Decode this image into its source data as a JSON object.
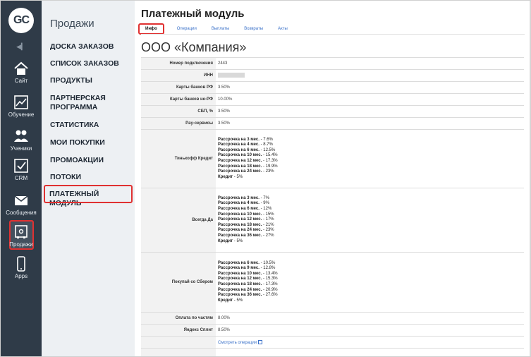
{
  "app": {
    "logo_text": "GC"
  },
  "rail": {
    "items": [
      {
        "label": "Сайт",
        "icon": "home-icon"
      },
      {
        "label": "Обучение",
        "icon": "chart-icon"
      },
      {
        "label": "Ученики",
        "icon": "users-icon"
      },
      {
        "label": "CRM",
        "icon": "checkbox-icon"
      },
      {
        "label": "Сообщения",
        "icon": "mail-icon"
      },
      {
        "label": "Продажи",
        "icon": "safe-icon",
        "active": true
      },
      {
        "label": "Apps",
        "icon": "phone-icon"
      }
    ]
  },
  "section_nav": {
    "title": "Продажи",
    "items": [
      {
        "label": "ДОСКА ЗАКАЗОВ"
      },
      {
        "label": "СПИСОК ЗАКАЗОВ"
      },
      {
        "label": "ПРОДУКТЫ"
      },
      {
        "label": "ПАРТНЕРСКАЯ ПРОГРАММА"
      },
      {
        "label": "СТАТИСТИКА"
      },
      {
        "label": "МОИ ПОКУПКИ"
      },
      {
        "label": "ПРОМОАКЦИИ"
      },
      {
        "label": "ПОТОКИ"
      },
      {
        "label": "ПЛАТЕЖНЫЙ МОДУЛЬ",
        "active": true
      }
    ]
  },
  "main": {
    "title": "Платежный модуль",
    "tabs": [
      {
        "label": "Инфо",
        "active": true
      },
      {
        "label": "Операции"
      },
      {
        "label": "Выплаты"
      },
      {
        "label": "Возвраты"
      },
      {
        "label": "Акты"
      }
    ],
    "company": "ООО «Компания»",
    "rows": [
      {
        "key": "Номер подключения",
        "value": "2443"
      },
      {
        "key": "ИНН",
        "value": "",
        "masked": true
      },
      {
        "key": "Карты банков РФ",
        "value": "3.50%"
      },
      {
        "key": "Карты банков не-РФ",
        "value": "10.00%"
      },
      {
        "key": "СБП, %",
        "value": "3.50%"
      },
      {
        "key": "Pay-сервисы",
        "value": "3.50%"
      },
      {
        "key": "Тинькофф Кредит",
        "plans": [
          {
            "name": "Рассрочка на 3 мес.",
            "rate": "- 7.6%"
          },
          {
            "name": "Рассрочка на 4 мес.",
            "rate": "- 8.7%"
          },
          {
            "name": "Рассрочка на 6 мес.",
            "rate": "- 12.5%"
          },
          {
            "name": "Рассрочка на 10 мес.",
            "rate": "- 15.4%"
          },
          {
            "name": "Рассрочка на 12 мес.",
            "rate": "- 17.3%"
          },
          {
            "name": "Рассрочка на 18 мес.",
            "rate": "- 19.9%"
          },
          {
            "name": "Рассрочка на 24 мес.",
            "rate": "- 23%"
          },
          {
            "name": "Кредит",
            "rate": "- 5%"
          }
        ]
      },
      {
        "key": "Всегда Да",
        "plans": [
          {
            "name": "Рассрочка на 3 мес.",
            "rate": "- 7%"
          },
          {
            "name": "Рассрочка на 4 мес.",
            "rate": "- 9%"
          },
          {
            "name": "Рассрочка на 6 мес.",
            "rate": "- 12%"
          },
          {
            "name": "Рассрочка на 10 мес.",
            "rate": "- 15%"
          },
          {
            "name": "Рассрочка на 12 мес.",
            "rate": "- 17%"
          },
          {
            "name": "Рассрочка на 18 мес.",
            "rate": "- 21%"
          },
          {
            "name": "Рассрочка на 24 мес.",
            "rate": "- 23%"
          },
          {
            "name": "Рассрочка на 36 мес.",
            "rate": "- 27%"
          },
          {
            "name": "Кредит",
            "rate": "- 5%"
          }
        ]
      },
      {
        "key": "Покупай со Сбером",
        "plans": [
          {
            "name": "Рассрочка на 6 мес.",
            "rate": "- 10.5%"
          },
          {
            "name": "Рассрочка на 9 мес.",
            "rate": "- 12.8%"
          },
          {
            "name": "Рассрочка на 10 мес.",
            "rate": "- 13.4%"
          },
          {
            "name": "Рассрочка на 12 мес.",
            "rate": "- 15.3%"
          },
          {
            "name": "Рассрочка на 18 мес.",
            "rate": "- 17.3%"
          },
          {
            "name": "Рассрочка на 24 мес.",
            "rate": "- 20.9%"
          },
          {
            "name": "Рассрочка на 36 мес.",
            "rate": "- 27.6%"
          },
          {
            "name": "Кредит",
            "rate": "- 5%"
          }
        ]
      },
      {
        "key": "Оплата по частям",
        "value": "8.00%"
      },
      {
        "key": "Яндекс Сплит",
        "value": "8.50%"
      },
      {
        "key": "",
        "link": "Смотреть операции"
      }
    ]
  },
  "colors": {
    "rail": "#2f3b48",
    "highlight": "#e03131",
    "link": "#3a71c9"
  }
}
